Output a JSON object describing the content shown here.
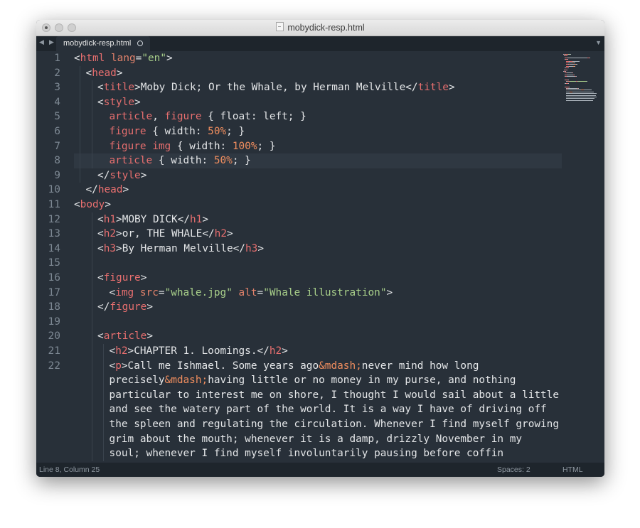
{
  "window": {
    "title": "mobydick-resp.html"
  },
  "tab": {
    "label": "mobydick-resp.html"
  },
  "status": {
    "position": "Line 8, Column 25",
    "spaces": "Spaces: 2",
    "syntax": "HTML"
  },
  "colors": {
    "tag": "#e86f6f",
    "attribute": "#e2826b",
    "string": "#a8cf8a",
    "number": "#ef8d5e",
    "text": "#e4e6e8",
    "background": "#283039"
  },
  "editor": {
    "line_numbers": [
      "1",
      "2",
      "3",
      "4",
      "5",
      "6",
      "7",
      "8",
      "9",
      "10",
      "11",
      "12",
      "13",
      "14",
      "15",
      "16",
      "17",
      "18",
      "19",
      "20",
      "21",
      "22"
    ],
    "current_line": 8,
    "lines": [
      {
        "indent": 0,
        "segs": [
          [
            "t",
            "<"
          ],
          [
            "tag",
            "html"
          ],
          [
            "t",
            " "
          ],
          [
            "attr",
            "lang"
          ],
          [
            "t",
            "="
          ],
          [
            "str",
            "\"en\""
          ],
          [
            "t",
            ">"
          ]
        ]
      },
      {
        "indent": 2,
        "segs": [
          [
            "t",
            "<"
          ],
          [
            "tag",
            "head"
          ],
          [
            "t",
            ">"
          ]
        ]
      },
      {
        "indent": 4,
        "segs": [
          [
            "t",
            "<"
          ],
          [
            "tag",
            "title"
          ],
          [
            "t",
            ">Moby Dick; Or the Whale, by Herman Melville</"
          ],
          [
            "tag",
            "title"
          ],
          [
            "t",
            ">"
          ]
        ]
      },
      {
        "indent": 4,
        "segs": [
          [
            "t",
            "<"
          ],
          [
            "tag",
            "style"
          ],
          [
            "t",
            ">"
          ]
        ]
      },
      {
        "indent": 6,
        "segs": [
          [
            "tag",
            "article"
          ],
          [
            "t",
            ", "
          ],
          [
            "tag",
            "figure"
          ],
          [
            "t",
            " { float: left; }"
          ]
        ]
      },
      {
        "indent": 6,
        "segs": [
          [
            "tag",
            "figure"
          ],
          [
            "t",
            " { width: "
          ],
          [
            "num",
            "50%"
          ],
          [
            "t",
            "; }"
          ]
        ]
      },
      {
        "indent": 6,
        "segs": [
          [
            "tag",
            "figure"
          ],
          [
            "t",
            " "
          ],
          [
            "tag",
            "img"
          ],
          [
            "t",
            " { width: "
          ],
          [
            "num",
            "100%"
          ],
          [
            "t",
            "; }"
          ]
        ]
      },
      {
        "indent": 6,
        "segs": [
          [
            "tag",
            "article"
          ],
          [
            "t",
            " { width: "
          ],
          [
            "num",
            "50%"
          ],
          [
            "t",
            "; }"
          ]
        ]
      },
      {
        "indent": 4,
        "segs": [
          [
            "t",
            "</"
          ],
          [
            "tag",
            "style"
          ],
          [
            "t",
            ">"
          ]
        ]
      },
      {
        "indent": 2,
        "segs": [
          [
            "t",
            "</"
          ],
          [
            "tag",
            "head"
          ],
          [
            "t",
            ">"
          ]
        ]
      },
      {
        "indent": 0,
        "segs": [
          [
            "t",
            "<"
          ],
          [
            "tag",
            "body"
          ],
          [
            "t",
            ">"
          ]
        ]
      },
      {
        "indent": 4,
        "segs": [
          [
            "t",
            "<"
          ],
          [
            "tag",
            "h1"
          ],
          [
            "t",
            ">MOBY DICK</"
          ],
          [
            "tag",
            "h1"
          ],
          [
            "t",
            ">"
          ]
        ]
      },
      {
        "indent": 4,
        "segs": [
          [
            "t",
            "<"
          ],
          [
            "tag",
            "h2"
          ],
          [
            "t",
            ">or, THE WHALE</"
          ],
          [
            "tag",
            "h2"
          ],
          [
            "t",
            ">"
          ]
        ]
      },
      {
        "indent": 4,
        "segs": [
          [
            "t",
            "<"
          ],
          [
            "tag",
            "h3"
          ],
          [
            "t",
            ">By Herman Melville</"
          ],
          [
            "tag",
            "h3"
          ],
          [
            "t",
            ">"
          ]
        ]
      },
      {
        "indent": 0,
        "segs": []
      },
      {
        "indent": 4,
        "segs": [
          [
            "t",
            "<"
          ],
          [
            "tag",
            "figure"
          ],
          [
            "t",
            ">"
          ]
        ]
      },
      {
        "indent": 6,
        "segs": [
          [
            "t",
            "<"
          ],
          [
            "tag",
            "img"
          ],
          [
            "t",
            " "
          ],
          [
            "attr",
            "src"
          ],
          [
            "t",
            "="
          ],
          [
            "str",
            "\"whale.jpg\""
          ],
          [
            "t",
            " "
          ],
          [
            "attr",
            "alt"
          ],
          [
            "t",
            "="
          ],
          [
            "str",
            "\"Whale illustration\""
          ],
          [
            "t",
            ">"
          ]
        ]
      },
      {
        "indent": 4,
        "segs": [
          [
            "t",
            "</"
          ],
          [
            "tag",
            "figure"
          ],
          [
            "t",
            ">"
          ]
        ]
      },
      {
        "indent": 0,
        "segs": []
      },
      {
        "indent": 4,
        "segs": [
          [
            "t",
            "<"
          ],
          [
            "tag",
            "article"
          ],
          [
            "t",
            ">"
          ]
        ]
      },
      {
        "indent": 6,
        "segs": [
          [
            "t",
            "<"
          ],
          [
            "tag",
            "h2"
          ],
          [
            "t",
            ">CHAPTER 1. Loomings.</"
          ],
          [
            "tag",
            "h2"
          ],
          [
            "t",
            ">"
          ]
        ]
      },
      {
        "indent": 6,
        "segs": [
          [
            "t",
            "<"
          ],
          [
            "tag",
            "p"
          ],
          [
            "t",
            ">Call me Ishmael. Some years ago"
          ],
          [
            "ent",
            "&mdash;"
          ],
          [
            "t",
            "never mind how long"
          ]
        ]
      },
      {
        "indent": 6,
        "segs": [
          [
            "t",
            "precisely"
          ],
          [
            "ent",
            "&mdash;"
          ],
          [
            "t",
            "having little or no money in my purse, and nothing"
          ]
        ]
      },
      {
        "indent": 6,
        "segs": [
          [
            "t",
            "particular to interest me on shore, I thought I would sail about a little"
          ]
        ]
      },
      {
        "indent": 6,
        "segs": [
          [
            "t",
            "and see the watery part of the world. It is a way I have of driving off"
          ]
        ]
      },
      {
        "indent": 6,
        "segs": [
          [
            "t",
            "the spleen and regulating the circulation. Whenever I find myself growing"
          ]
        ]
      },
      {
        "indent": 6,
        "segs": [
          [
            "t",
            "grim about the mouth; whenever it is a damp, drizzly November in my"
          ]
        ]
      },
      {
        "indent": 6,
        "segs": [
          [
            "t",
            "soul; whenever I find myself involuntarily pausing before coffin"
          ]
        ]
      }
    ]
  }
}
